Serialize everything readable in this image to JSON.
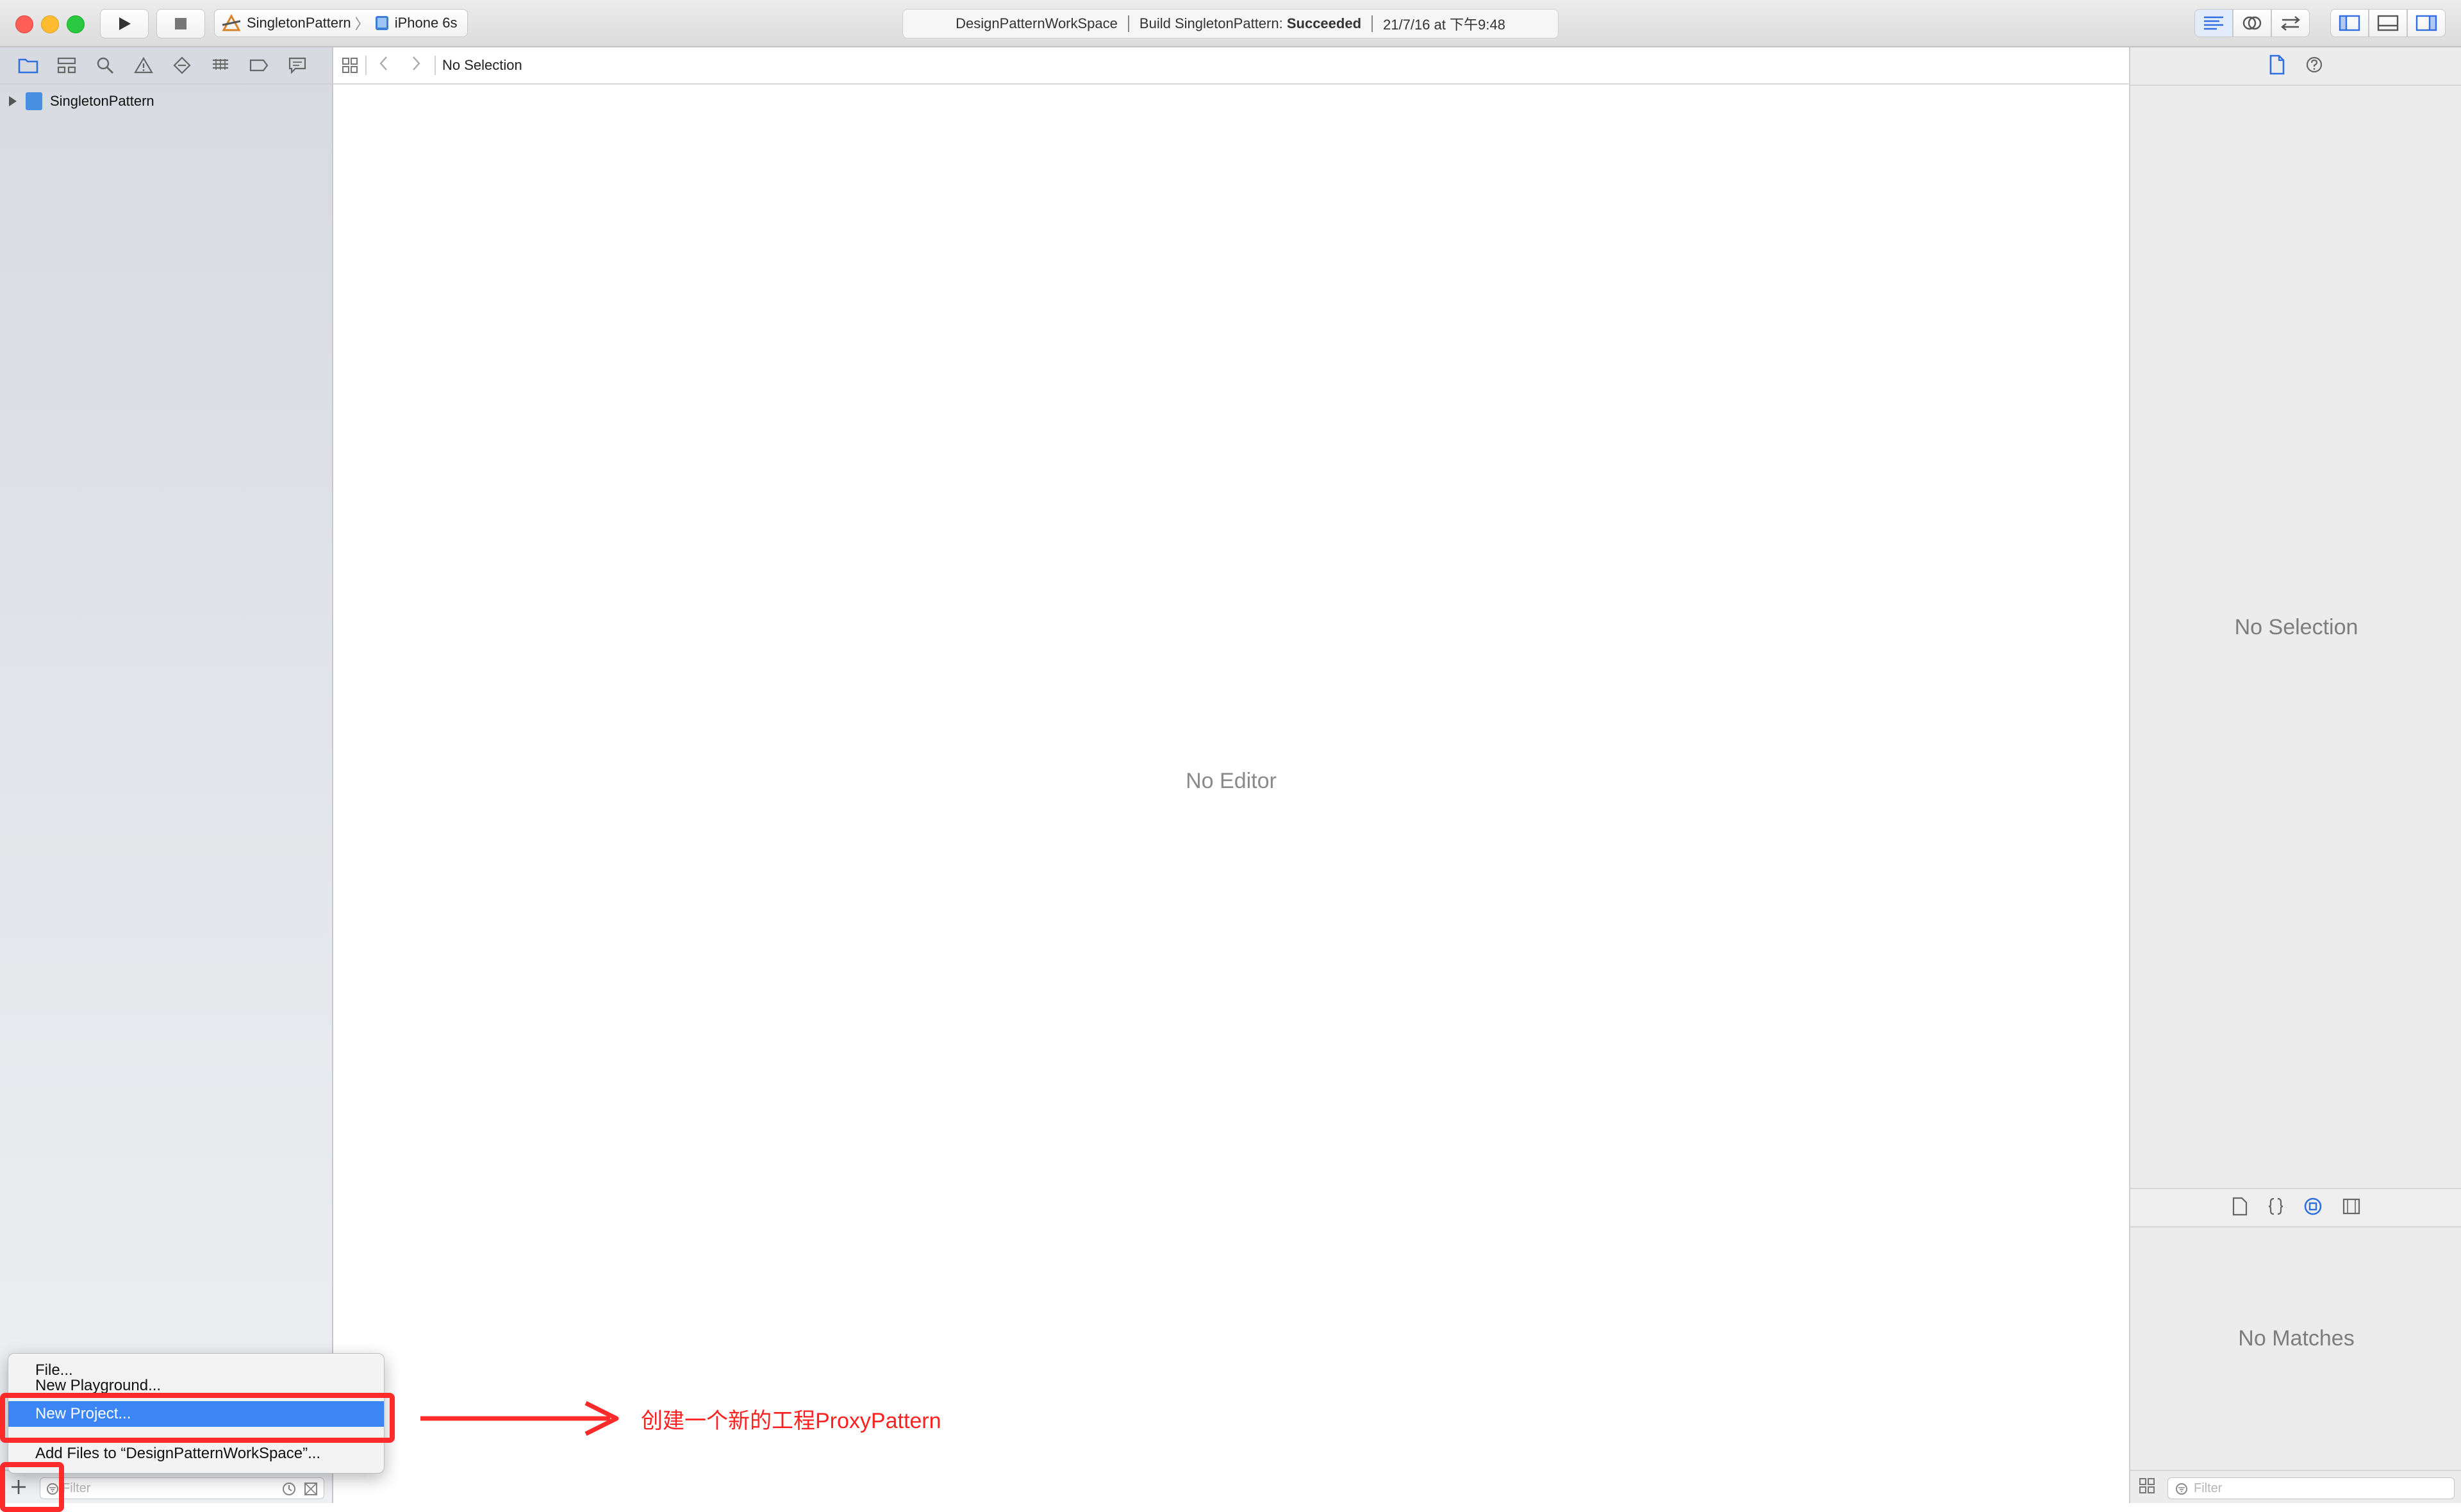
{
  "toolbar": {
    "run_icon": "play-icon",
    "stop_icon": "stop-icon",
    "scheme_name": "SingletonPattern",
    "scheme_separator": "〉",
    "device_name": "iPhone 6s",
    "activity": {
      "workspace": "DesignPatternWorkSpace",
      "build_prefix": "Build SingletonPattern: ",
      "build_status": "Succeeded",
      "timestamp": "21/7/16 at 下午9:48"
    }
  },
  "navigator": {
    "tab_icons": [
      "folder-icon",
      "hierarchy-icon",
      "search-icon",
      "warning-icon",
      "diamond-icon",
      "tests-icon",
      "breakpoint-icon",
      "report-icon"
    ],
    "project_item": "SingletonPattern",
    "filter_placeholder": "Filter"
  },
  "popup_menu": {
    "items": [
      "File...",
      "New Playground...",
      "New Project...",
      "Add Files to “DesignPatternWorkSpace”..."
    ],
    "selected_index": 2
  },
  "editor": {
    "jump_bar_text": "No Selection",
    "placeholder": "No Editor"
  },
  "inspector": {
    "no_selection": "No Selection",
    "no_matches": "No Matches",
    "filter_placeholder": "Filter"
  },
  "annotation": {
    "text": "创建一个新的工程ProxyPattern",
    "color": "#ff2020"
  }
}
